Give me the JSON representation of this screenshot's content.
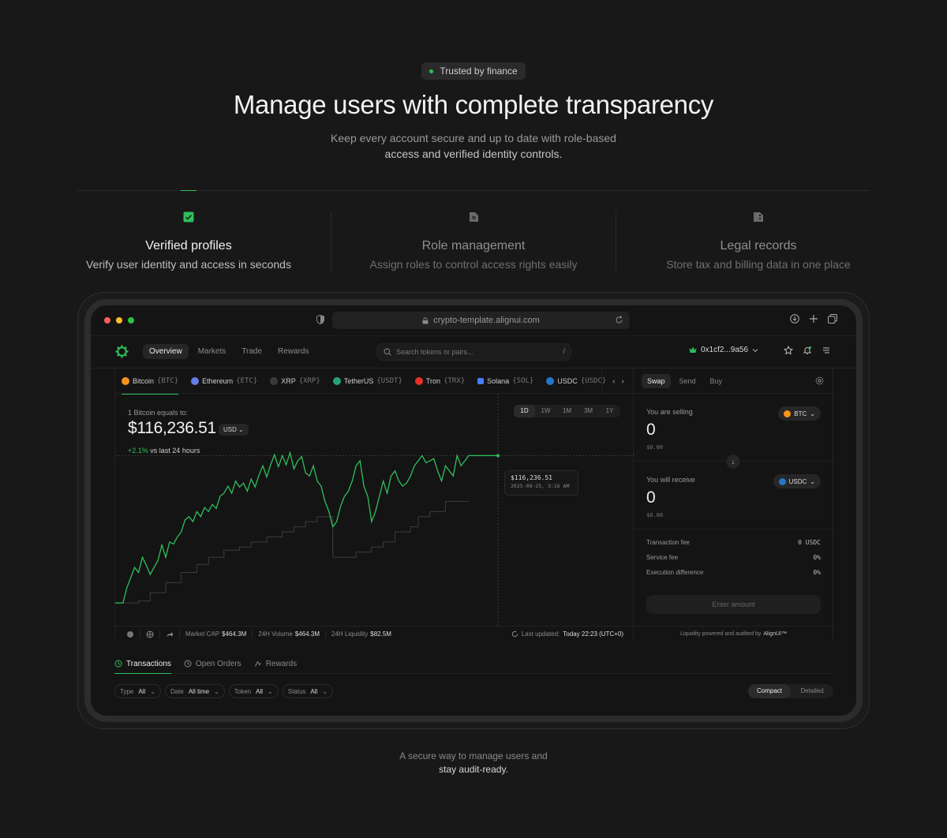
{
  "hero": {
    "badge": "Trusted by finance",
    "title": "Manage users with complete transparency",
    "subtitle_line1": "Keep every account secure and up to date with role-based",
    "subtitle_line2": "access and verified identity controls."
  },
  "features": [
    {
      "title": "Verified profiles",
      "desc": "Verify user identity and access in seconds",
      "icon": "check-square-icon"
    },
    {
      "title": "Role management",
      "desc": "Assign roles to control access rights easily",
      "icon": "settings-file-icon"
    },
    {
      "title": "Legal records",
      "desc": "Store tax and billing data in one place",
      "icon": "document-icon"
    }
  ],
  "browser": {
    "url": "crypto-template.alignui.com"
  },
  "app": {
    "nav_tabs": [
      "Overview",
      "Markets",
      "Trade",
      "Rewards"
    ],
    "search_placeholder": "Search tokens or pairs...",
    "search_shortcut": "/",
    "wallet": "0x1cf2...9a56"
  },
  "coins": [
    {
      "name": "Bitcoin",
      "symbol": "{BTC}",
      "color": "#f7931a"
    },
    {
      "name": "Ethereum",
      "symbol": "{ETC}",
      "color": "#627eea"
    },
    {
      "name": "XRP",
      "symbol": "{XRP}",
      "color": "#3a3a3a"
    },
    {
      "name": "TetherUS",
      "symbol": "{USDT}",
      "color": "#26a17b"
    },
    {
      "name": "Tron",
      "symbol": "{TRX}",
      "color": "#e5312b"
    },
    {
      "name": "Solana",
      "symbol": "{SOL}",
      "color": "#4a7cff"
    },
    {
      "name": "USDC",
      "symbol": "{USDC}",
      "color": "#2775ca"
    }
  ],
  "overview": {
    "equals_label": "1 Bitcoin equals to:",
    "price": "$116,236.51",
    "currency": "USD",
    "change_pct": "+2.1%",
    "change_label": "vs last 24 hours",
    "ranges": [
      "1D",
      "1W",
      "1M",
      "3M",
      "1Y"
    ],
    "tooltip_value": "$116,236.51",
    "tooltip_date": "2025-09-25, 3:16 AM"
  },
  "chart_data": {
    "type": "line",
    "y_range": [
      0,
      100
    ],
    "series": [
      {
        "values": [
          10,
          10,
          10,
          25,
          35,
          45,
          40,
          55,
          47,
          38,
          45,
          52,
          67,
          55,
          70,
          68,
          75,
          80,
          92,
          95,
          90,
          100,
          95,
          104,
          100,
          107,
          103,
          115,
          118,
          125,
          118,
          130,
          124,
          128,
          120,
          132,
          124,
          136,
          145,
          134,
          146,
          156,
          144,
          155,
          146,
          158,
          142,
          150,
          154,
          138,
          135,
          145,
          130,
          125,
          110,
          100,
          85,
          90,
          105,
          115,
          120,
          130,
          145,
          150,
          125,
          115,
          90,
          100,
          115,
          130,
          118,
          135,
          140,
          130,
          125,
          128,
          135,
          145,
          150,
          155,
          148,
          150,
          152,
          140,
          130,
          145,
          140,
          135,
          155,
          145,
          150,
          155
        ]
      },
      {
        "values": [
          10,
          10,
          10,
          10,
          10,
          10,
          12,
          12,
          12,
          20,
          20,
          20,
          20,
          30,
          30,
          30,
          30,
          40,
          40,
          40,
          40,
          48,
          48,
          48,
          55,
          55,
          55,
          55,
          62,
          62,
          62,
          62,
          65,
          65,
          65,
          70,
          70,
          70,
          70,
          75,
          75,
          75,
          75,
          80,
          80,
          80,
          85,
          85,
          85,
          90,
          90,
          90,
          95,
          95,
          95,
          95,
          55,
          55,
          55,
          55,
          55,
          55,
          60,
          60,
          60,
          60,
          65,
          65,
          65,
          70,
          70,
          70,
          80,
          80,
          80,
          80,
          85,
          85,
          95,
          95,
          95,
          100,
          100,
          100,
          100,
          110,
          110,
          110,
          110,
          110,
          110,
          110
        ]
      }
    ]
  },
  "stats": {
    "market_cap_label": "Market CAP",
    "market_cap": "$464.3M",
    "volume_label": "24H Volume",
    "volume": "$464.3M",
    "liquidity_label": "24H Liquidity",
    "liquidity": "$82.5M",
    "updated_label": "Last updated:",
    "updated": "Today 22:23 (UTC+0)"
  },
  "swap": {
    "tabs": [
      "Swap",
      "Send",
      "Buy"
    ],
    "selling_label": "You are selling",
    "selling_amount": "0",
    "selling_usd": "$0.00",
    "selling_token": "BTC",
    "receive_label": "You will receive",
    "receive_amount": "0",
    "receive_usd": "$0.00",
    "receive_token": "USDC",
    "fees": [
      {
        "label": "Transaction fee",
        "value": "0 USDC"
      },
      {
        "label": "Service fee",
        "value": "0%"
      },
      {
        "label": "Execution difference",
        "value": "0%"
      }
    ],
    "enter_amount": "Enter amount",
    "liquidity_note": "Liquidity powered and audited by",
    "liquidity_brand": "AlignUI™"
  },
  "bottom": {
    "tabs": [
      "Transactions",
      "Open Orders",
      "Rewards"
    ],
    "filters": [
      {
        "label": "Type",
        "value": "All"
      },
      {
        "label": "Date",
        "value": "All time"
      },
      {
        "label": "Token",
        "value": "All"
      },
      {
        "label": "Status",
        "value": "All"
      }
    ],
    "view_modes": [
      "Compact",
      "Detailed"
    ]
  },
  "footer": {
    "line1": "A secure way to manage users and",
    "line2": "stay audit-ready."
  },
  "colors": {
    "accent": "#2fbf5b",
    "background": "#181818"
  }
}
